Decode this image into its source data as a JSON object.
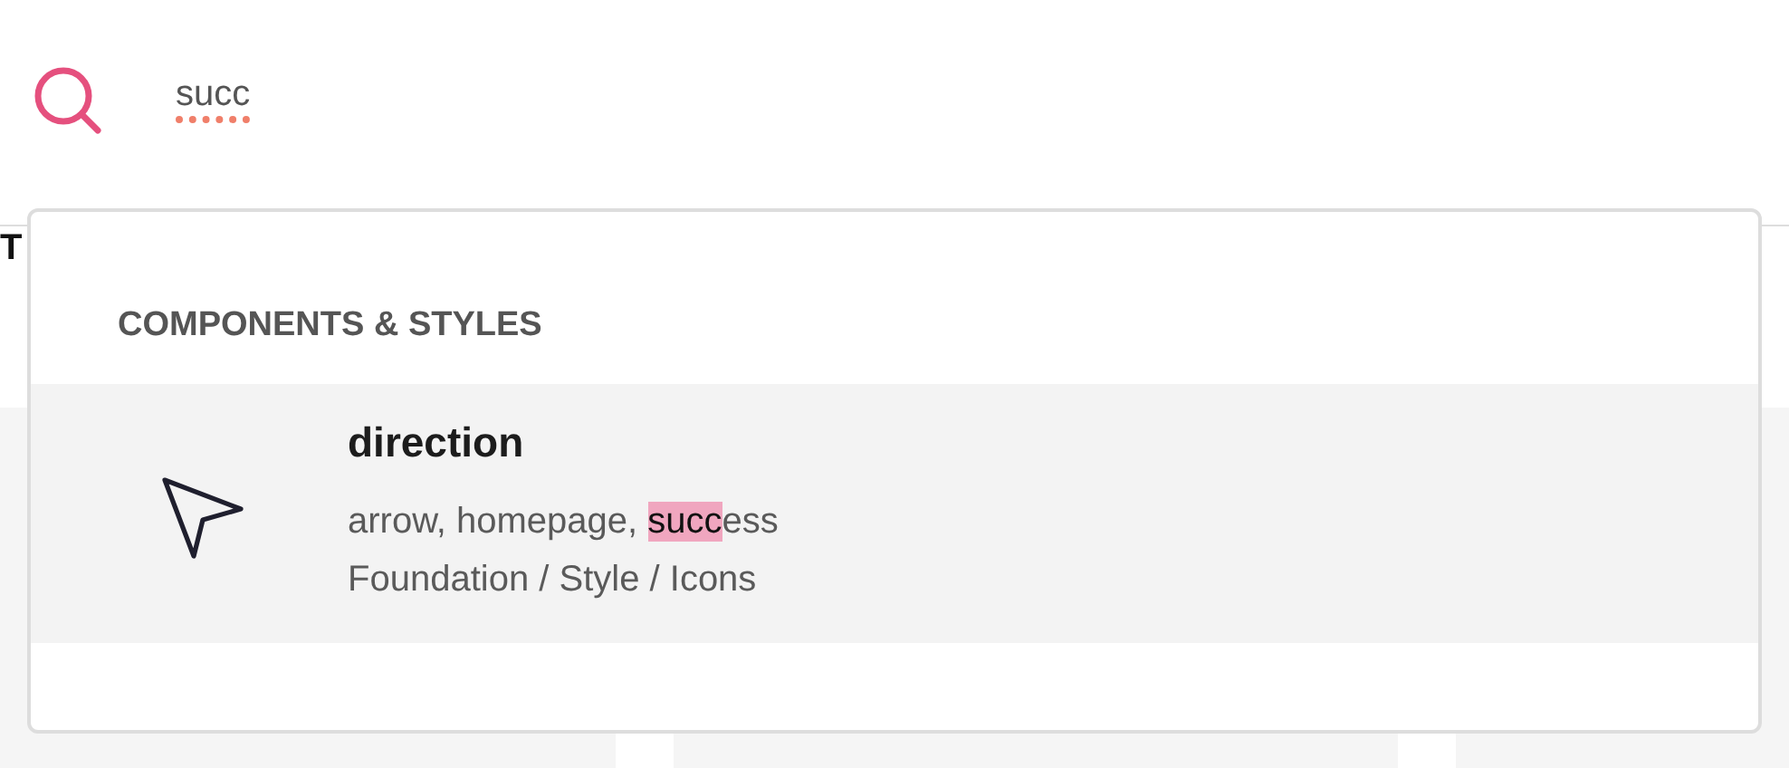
{
  "search": {
    "value": "succ",
    "misspelled": true
  },
  "background": {
    "heading": "T"
  },
  "dropdown": {
    "section": "COMPONENTS & STYLES",
    "results": [
      {
        "title": "direction",
        "selected": true,
        "keywords": [
          {
            "text": "arrow, homepage, ",
            "highlighted": false
          },
          {
            "text": "succ",
            "highlighted": true
          },
          {
            "text": "ess",
            "highlighted": false
          }
        ],
        "path": "Foundation / Style / Icons"
      }
    ]
  }
}
